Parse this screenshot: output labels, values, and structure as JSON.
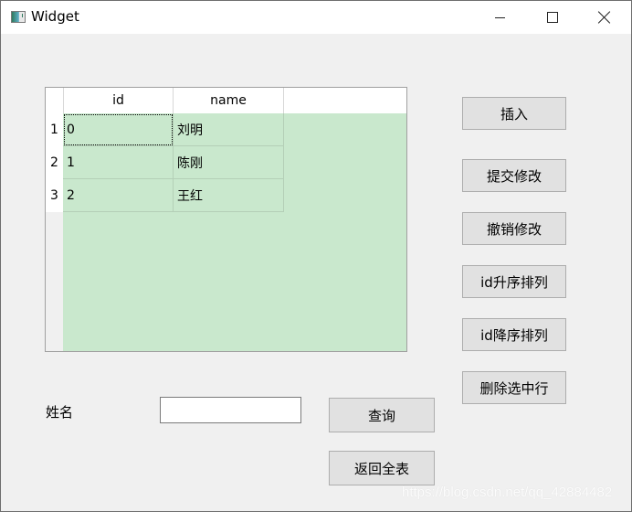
{
  "window": {
    "title": "Widget",
    "icon": "app-window-icon",
    "controls": {
      "minimize": "minimize-icon",
      "maximize": "maximize-icon",
      "close": "close-icon"
    }
  },
  "table": {
    "columns": [
      "id",
      "name"
    ],
    "rows": [
      {
        "header": "1",
        "id": "0",
        "name": "刘明"
      },
      {
        "header": "2",
        "id": "1",
        "name": "陈刚"
      },
      {
        "header": "3",
        "id": "2",
        "name": "王红"
      }
    ],
    "background_color": "#c9e8cd"
  },
  "buttons": {
    "insert": "插入",
    "submit_changes": "提交修改",
    "revert_changes": "撤销修改",
    "sort_id_asc": "id升序排列",
    "sort_id_desc": "id降序排列",
    "delete_selected": "删除选中行",
    "query": "查询",
    "show_all": "返回全表"
  },
  "search": {
    "label": "姓名",
    "value": "",
    "placeholder": ""
  },
  "watermark": "https://blog.csdn.net/qq_42884482"
}
